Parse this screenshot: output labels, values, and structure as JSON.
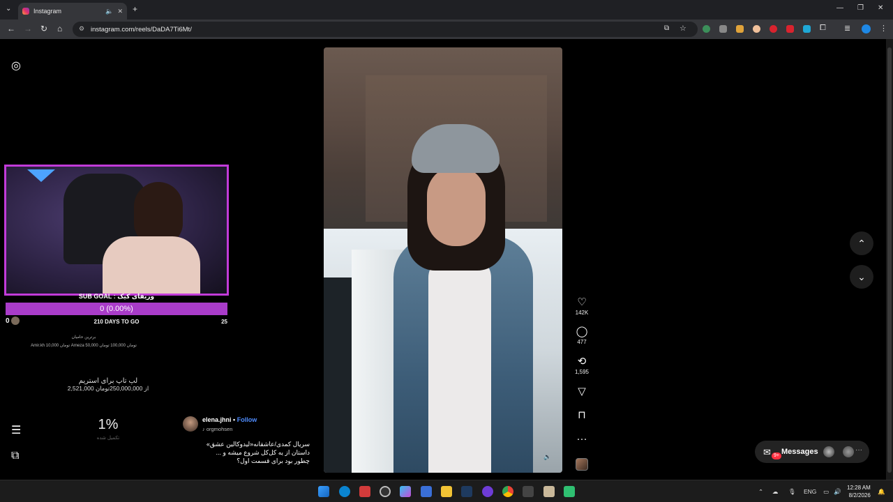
{
  "browser": {
    "tab_title": "Instagram",
    "url": "instagram.com/reels/DaDA7Ti6Mt/"
  },
  "stream_overlay": {
    "sub_goal_title": "SUB GOAL : وریفای کیک",
    "sub_goal_value": "0 (0.00%)",
    "left_count": "0",
    "days_to_go": "210 DAYS TO GO",
    "right_count": "25",
    "top_donors_title": "برترین حامیان",
    "top_donors_line": "Amir.kh 10,000 تومان   Arneza 50,000 تومان   100,000 تومان",
    "donation_title": "لپ تاپ برای استریم",
    "donation_progress": "2,521,000 از 250,000,000تومان",
    "percent": "1%",
    "percent_label": "تکمیل شده"
  },
  "reel": {
    "username": "elena.jhni",
    "separator": "•",
    "follow_label": "Follow",
    "audio_label": "orgmohsen",
    "caption_line1": "سریال کمدی/عاشقانه«لیدوکالین عشق»",
    "caption_line2": "داستان از یه کل‌کل شروع میشه و ...",
    "caption_line3": "چطور بود برای قسمت اول؟"
  },
  "actions": {
    "likes": "142K",
    "comments": "477",
    "reposts": "1,595"
  },
  "messages": {
    "label": "Messages",
    "badge": "9+"
  },
  "taskbar": {
    "lang": "ENG",
    "time": "12:28 AM",
    "date": "8/2/2026"
  },
  "colors": {
    "accent_purple": "#a93cc9",
    "follow_blue": "#4f8dff",
    "badge_red": "#ff3040"
  }
}
